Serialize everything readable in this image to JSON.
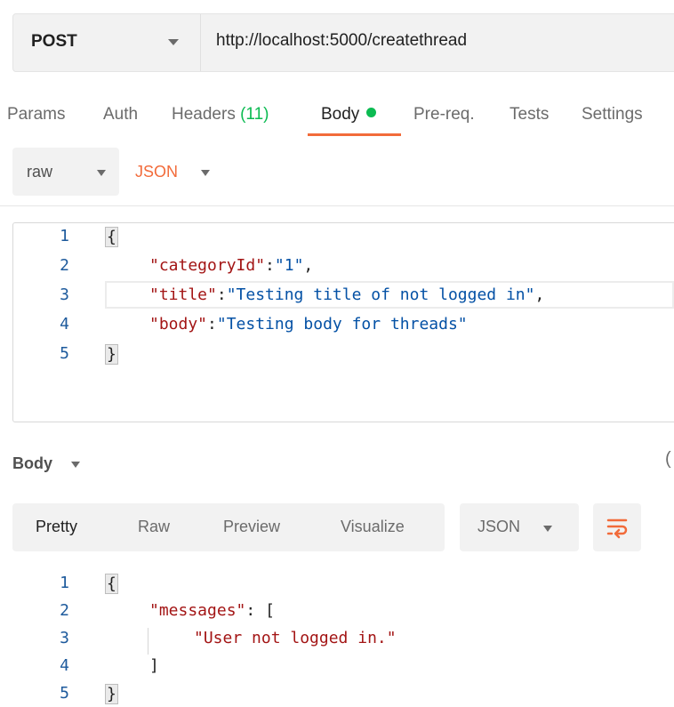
{
  "request": {
    "method": "POST",
    "url": "http://localhost:5000/createthread"
  },
  "tabs": {
    "params": "Params",
    "auth": "Auth",
    "headers": "Headers",
    "headers_count": "(11)",
    "body": "Body",
    "prereq": "Pre-req.",
    "tests": "Tests",
    "settings": "Settings"
  },
  "body_type": {
    "mode": "raw",
    "language": "JSON"
  },
  "request_body": {
    "line_numbers": [
      "1",
      "2",
      "3",
      "4",
      "5"
    ],
    "open": "{",
    "close": "}",
    "k1": "\"categoryId\"",
    "v1": "\"1\"",
    "k2": "\"title\"",
    "v2": "\"Testing title of not logged in\"",
    "k3": "\"body\"",
    "v3": "\"Testing body for threads\""
  },
  "response": {
    "section_label": "Body",
    "views": [
      "Pretty",
      "Raw",
      "Preview",
      "Visualize"
    ],
    "format": "JSON",
    "line_numbers": [
      "1",
      "2",
      "3",
      "4",
      "5"
    ],
    "open": "{",
    "close": "}",
    "key": "\"messages\"",
    "arr_open": "[",
    "arr_close": "]",
    "message": "\"User not logged in.\""
  },
  "colors": {
    "accent": "#f26b3a",
    "status_green": "#0cbb52",
    "json_key": "#a31515",
    "json_string": "#0451a5"
  },
  "icons": [
    "chevron-down-icon",
    "wrap-lines-icon"
  ]
}
